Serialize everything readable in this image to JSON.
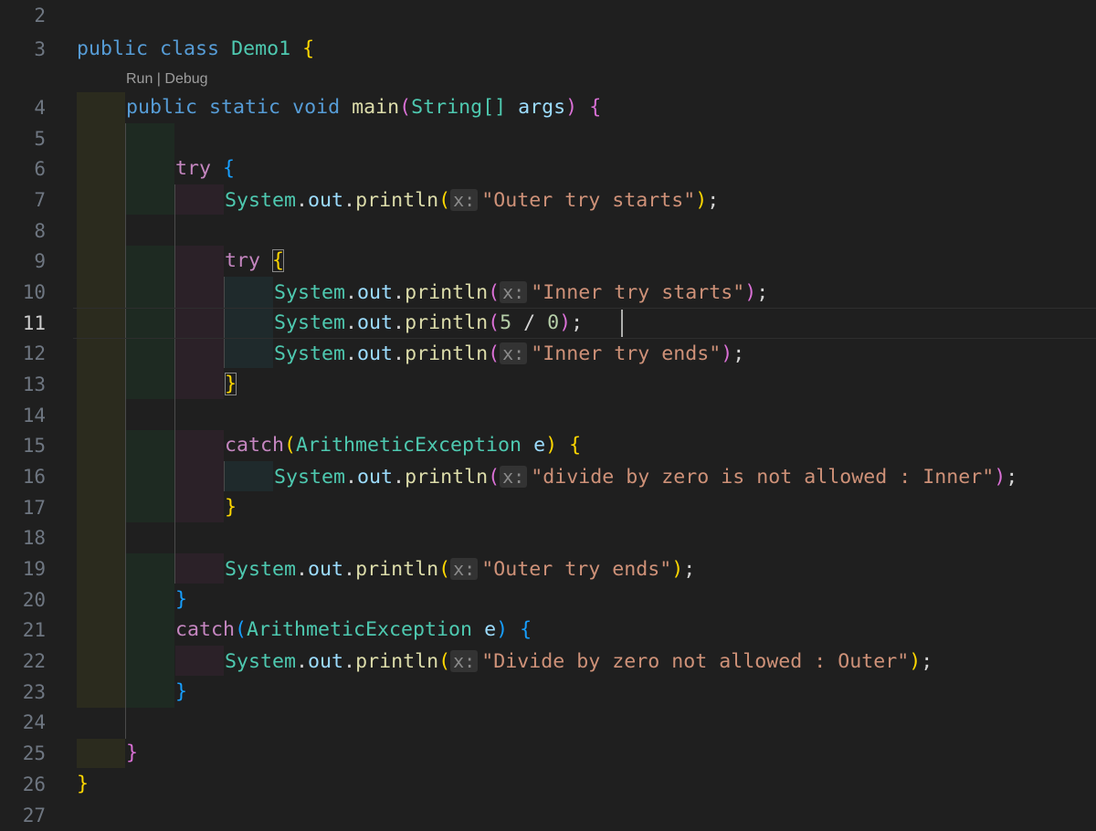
{
  "codelens": {
    "run": "Run",
    "separator": " | ",
    "debug": "Debug"
  },
  "line_numbers": [
    "2",
    "3",
    "4",
    "5",
    "6",
    "7",
    "8",
    "9",
    "10",
    "11",
    "12",
    "13",
    "14",
    "15",
    "16",
    "17",
    "18",
    "19",
    "20",
    "21",
    "22",
    "23",
    "24",
    "25",
    "26",
    "27"
  ],
  "active_line": "11",
  "code": {
    "l3": {
      "public": "public",
      "class": "class",
      "name": "Demo1",
      "brace": "{"
    },
    "l4": {
      "public": "public",
      "static": "static",
      "void": "void",
      "main": "main",
      "paren_open": "(",
      "string_type": "String[]",
      "args": "args",
      "paren_close": ")",
      "brace": "{"
    },
    "l6": {
      "try": "try",
      "brace": "{"
    },
    "l7": {
      "system": "System",
      "out": "out",
      "println": "println",
      "paren_open": "(",
      "hint": "x:",
      "string": "\"Outer try starts\"",
      "paren_close": ")",
      "semi": ";"
    },
    "l9": {
      "try": "try",
      "brace": "{"
    },
    "l10": {
      "system": "System",
      "out": "out",
      "println": "println",
      "paren_open": "(",
      "hint": "x:",
      "string": "\"Inner try starts\"",
      "paren_close": ")",
      "semi": ";"
    },
    "l11": {
      "system": "System",
      "out": "out",
      "println": "println",
      "paren_open": "(",
      "num1": "5",
      "op": " / ",
      "num2": "0",
      "paren_close": ")",
      "semi": ";"
    },
    "l12": {
      "system": "System",
      "out": "out",
      "println": "println",
      "paren_open": "(",
      "hint": "x:",
      "string": "\"Inner try ends\"",
      "paren_close": ")",
      "semi": ";"
    },
    "l13": {
      "brace": "}"
    },
    "l15": {
      "catch": "catch",
      "paren_open": "(",
      "exception": "ArithmeticException",
      "var": "e",
      "paren_close": ")",
      "brace": "{"
    },
    "l16": {
      "system": "System",
      "out": "out",
      "println": "println",
      "paren_open": "(",
      "hint": "x:",
      "string": "\"divide by zero is not allowed : Inner\"",
      "paren_close": ")",
      "semi": ";"
    },
    "l17": {
      "brace": "}"
    },
    "l19": {
      "system": "System",
      "out": "out",
      "println": "println",
      "paren_open": "(",
      "hint": "x:",
      "string": "\"Outer try ends\"",
      "paren_close": ")",
      "semi": ";"
    },
    "l20": {
      "brace": "}"
    },
    "l21": {
      "catch": "catch",
      "paren_open": "(",
      "exception": "ArithmeticException",
      "var": "e",
      "paren_close": ")",
      "brace": "{"
    },
    "l22": {
      "system": "System",
      "out": "out",
      "println": "println",
      "paren_open": "(",
      "hint": "x:",
      "string": "\"Divide by zero not allowed : Outer\"",
      "paren_close": ")",
      "semi": ";"
    },
    "l23": {
      "brace": "}"
    },
    "l25": {
      "brace": "}"
    },
    "l26": {
      "brace": "}"
    }
  },
  "colors": {
    "background": "#1f1f1f",
    "keyword": "#569cd6",
    "control": "#c586c0",
    "type": "#4ec9b0",
    "function": "#dcdcaa",
    "variable": "#9cdcfe",
    "string": "#ce9178",
    "number": "#b5cea8",
    "bracket_level1": "#ffd700",
    "bracket_level2": "#da70d6",
    "bracket_level3": "#179fff"
  }
}
